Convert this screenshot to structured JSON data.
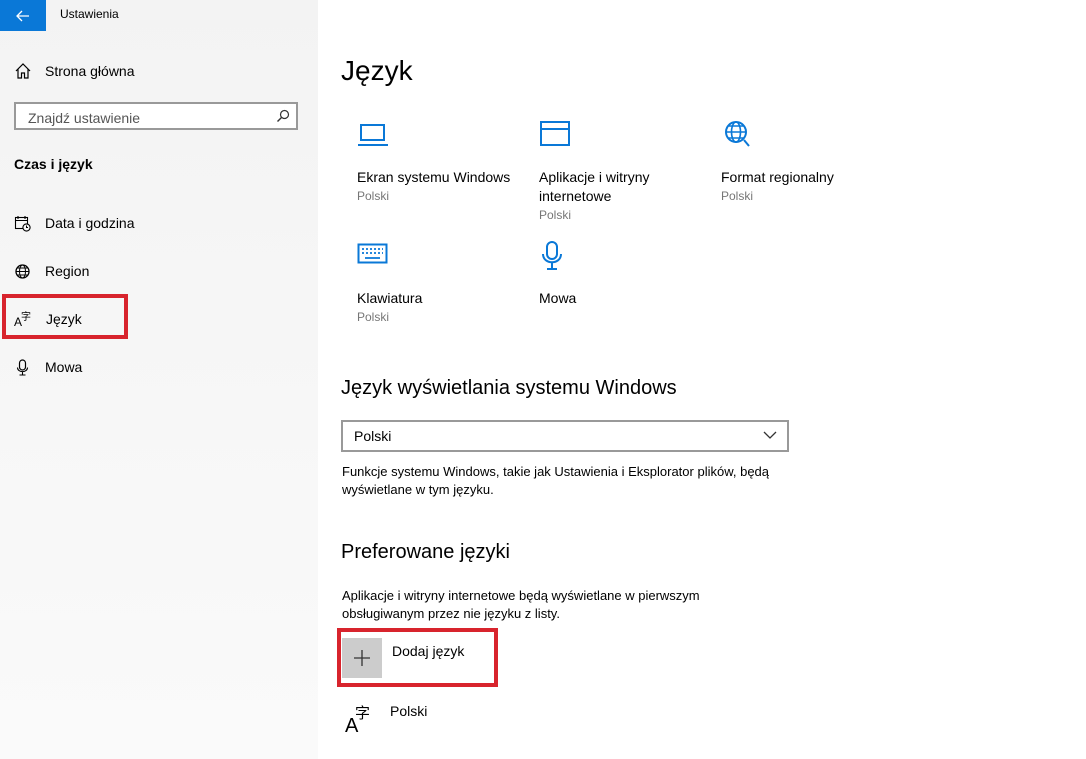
{
  "window": {
    "title": "Ustawienia"
  },
  "sidebar": {
    "home_label": "Strona główna",
    "search_placeholder": "Znajdź ustawienie",
    "section_title": "Czas i język",
    "items": [
      {
        "label": "Data i godzina",
        "icon": "calendar-clock-icon"
      },
      {
        "label": "Region",
        "icon": "globe-icon"
      },
      {
        "label": "Język",
        "icon": "language-icon",
        "selected": true
      },
      {
        "label": "Mowa",
        "icon": "microphone-icon"
      }
    ]
  },
  "main": {
    "title": "Język",
    "tiles": [
      {
        "name": "Ekran systemu Windows",
        "sub": "Polski",
        "icon": "laptop-icon"
      },
      {
        "name": "Aplikacje i witryny internetowe",
        "sub": "Polski",
        "icon": "window-icon"
      },
      {
        "name": "Format regionalny",
        "sub": "Polski",
        "icon": "globe-icon"
      },
      {
        "name": "Klawiatura",
        "sub": "Polski",
        "icon": "keyboard-icon"
      },
      {
        "name": "Mowa",
        "sub": "",
        "icon": "microphone-icon"
      }
    ],
    "display_lang": {
      "heading": "Język wyświetlania systemu Windows",
      "selected": "Polski",
      "description": "Funkcje systemu Windows, takie jak Ustawienia i Eksplorator plików, będą wyświetlane w tym języku."
    },
    "preferred": {
      "heading": "Preferowane języki",
      "description": "Aplikacje i witryny internetowe będą wyświetlane w pierwszym obsługiwanym przez nie języku z listy.",
      "add_label": "Dodaj język",
      "languages": [
        "Polski"
      ]
    }
  },
  "colors": {
    "accent": "#0a78d7",
    "highlight": "#d8242d"
  }
}
